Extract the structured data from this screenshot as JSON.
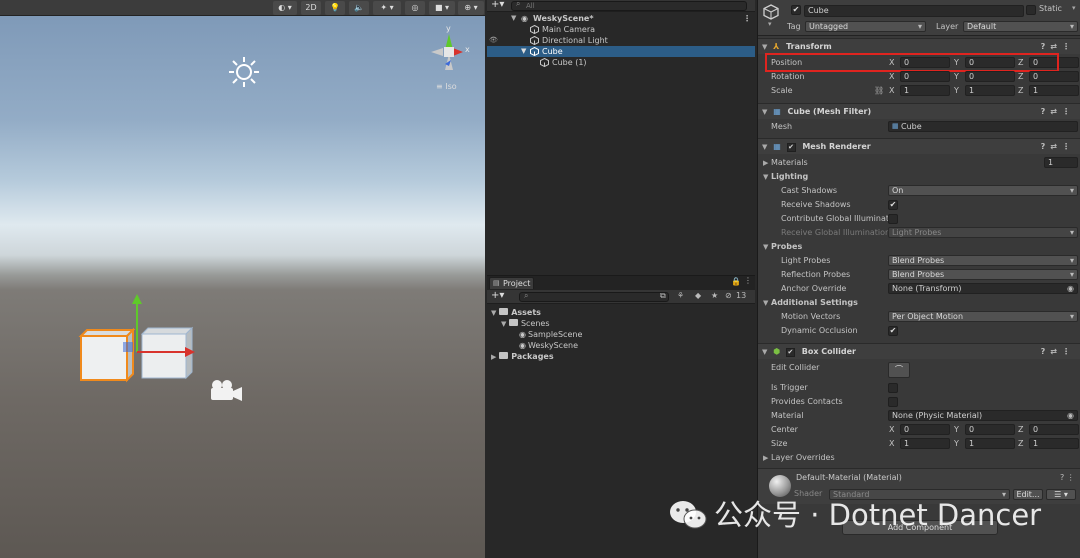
{
  "scene": {
    "toolbar": {
      "btn_2d": "2D"
    },
    "gizmo": {
      "y_label": "y",
      "x_label": "x",
      "iso_label": "≡ Iso"
    }
  },
  "hierarchy": {
    "search_placeholder": "All",
    "rows": [
      {
        "label": "WeskyScene*"
      },
      {
        "label": "Main Camera"
      },
      {
        "label": "Directional Light"
      },
      {
        "label": "Cube"
      },
      {
        "label": "Cube (1)"
      }
    ]
  },
  "project": {
    "tab_label": "Project",
    "hidden_count": "13",
    "tree": {
      "assets": "Assets",
      "scenes": "Scenes",
      "sample_scene": "SampleScene",
      "wesky_scene": "WeskyScene",
      "packages": "Packages"
    }
  },
  "inspector": {
    "object_name": "Cube",
    "static_label": "Static",
    "tag_label": "Tag",
    "tag_value": "Untagged",
    "layer_label": "Layer",
    "layer_value": "Default",
    "transform": {
      "title": "Transform",
      "position_label": "Position",
      "position": [
        "0",
        "0",
        "0"
      ],
      "rotation_label": "Rotation",
      "rotation": [
        "0",
        "0",
        "0"
      ],
      "scale_label": "Scale",
      "scale": [
        "1",
        "1",
        "1"
      ]
    },
    "axes": [
      "X",
      "Y",
      "Z"
    ],
    "mesh_filter": {
      "title": "Cube (Mesh Filter)",
      "mesh_label": "Mesh",
      "mesh_value": "Cube"
    },
    "mesh_renderer": {
      "title": "Mesh Renderer",
      "materials_label": "Materials",
      "materials_count": "1",
      "lighting_label": "Lighting",
      "cast_shadows_label": "Cast Shadows",
      "cast_shadows_value": "On",
      "receive_shadows_label": "Receive Shadows",
      "contribute_gi_label": "Contribute Global Illuminati",
      "receive_gi_label": "Receive Global Illumination",
      "receive_gi_value": "Light Probes",
      "probes_label": "Probes",
      "light_probes_label": "Light Probes",
      "light_probes_value": "Blend Probes",
      "reflection_probes_label": "Reflection Probes",
      "reflection_probes_value": "Blend Probes",
      "anchor_override_label": "Anchor Override",
      "anchor_override_value": "None (Transform)",
      "additional_settings_label": "Additional Settings",
      "motion_vectors_label": "Motion Vectors",
      "motion_vectors_value": "Per Object Motion",
      "dynamic_occlusion_label": "Dynamic Occlusion"
    },
    "box_collider": {
      "title": "Box Collider",
      "edit_collider_label": "Edit Collider",
      "is_trigger_label": "Is Trigger",
      "provides_contacts_label": "Provides Contacts",
      "material_label": "Material",
      "material_value": "None (Physic Material)",
      "center_label": "Center",
      "center": [
        "0",
        "0",
        "0"
      ],
      "size_label": "Size",
      "size": [
        "1",
        "1",
        "1"
      ],
      "layer_overrides_label": "Layer Overrides"
    },
    "material": {
      "title": "Default-Material (Material)",
      "shader_label": "Shader",
      "shader_value": "Standard",
      "edit_label": "Edit..."
    },
    "add_component_label": "Add Component"
  },
  "watermark": "公众号 · Dotnet Dancer",
  "colors": {
    "selection": "#2c5d87",
    "highlight_box": "#e0241f",
    "x_axis": "#d8332c",
    "y_axis": "#5fc92a",
    "z_axis": "#3d6bd8"
  }
}
